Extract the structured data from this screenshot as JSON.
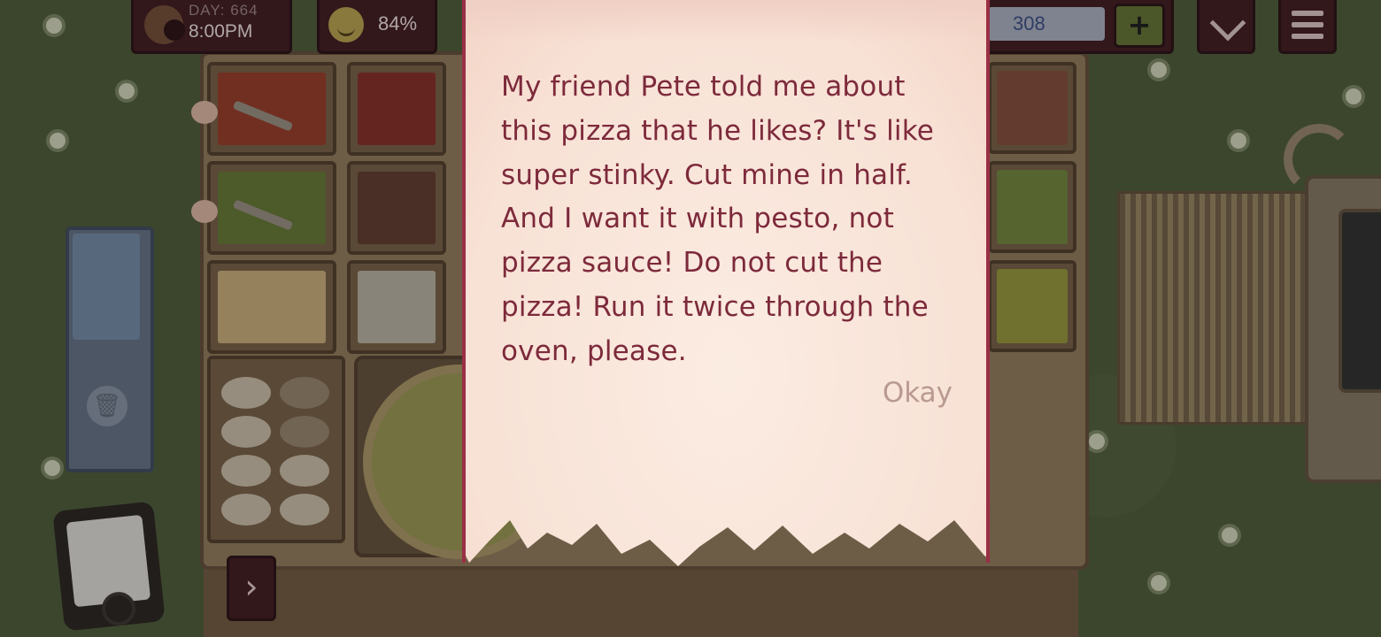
{
  "hud": {
    "day_label": "DAY: 664",
    "time": "8:00PM",
    "mood_percent": "84%",
    "coins": "308",
    "plus_label": "+"
  },
  "dialog": {
    "message": "My friend Pete told me about this pizza that he likes? It's like super stinky. Cut mine in half. And I want it with pesto, not pizza sauce! Do not cut the pizza! Run it twice through the oven, please.",
    "okay_label": "Okay"
  },
  "icons": {
    "sun": "sun-icon",
    "mood": "smiley-icon",
    "coin": "gem-icon",
    "plus": "plus-icon",
    "collapse": "chevron-down-icon",
    "menu": "hamburger-menu-icon",
    "trash": "trash-icon",
    "next": "chevron-right-icon"
  },
  "colors": {
    "hud_bg": "#3d1d22",
    "note_text": "#7d2a3b",
    "note_border": "#9a2f45",
    "okay": "#b99a91"
  }
}
